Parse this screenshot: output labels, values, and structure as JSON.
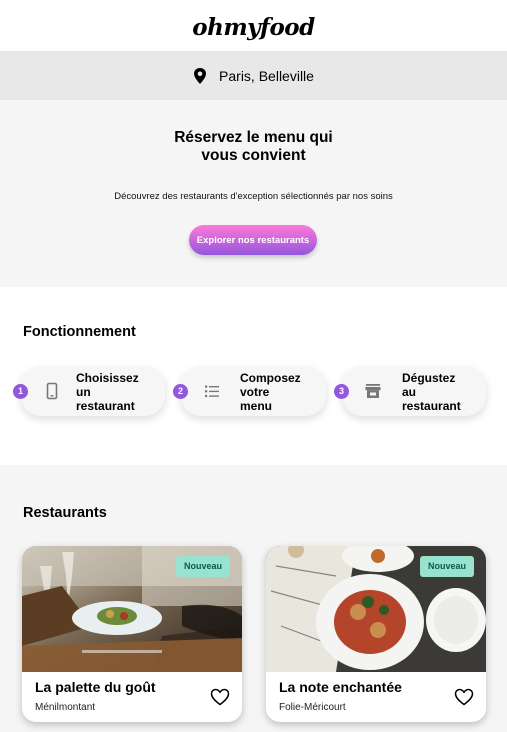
{
  "header": {
    "logo": "ohmyfood"
  },
  "location": {
    "icon": "map-pin-icon",
    "text": "Paris, Belleville"
  },
  "hero": {
    "title_line1": "Réservez le menu qui",
    "title_line2": "vous convient",
    "subtitle": "Découvrez des restaurants d'exception sélectionnés par nos soins",
    "cta_label": "Explorer nos restaurants"
  },
  "how_it_works": {
    "title": "Fonctionnement",
    "steps": [
      {
        "number": "1",
        "icon": "mobile-phone-icon",
        "lines": [
          "Choisissez",
          "un",
          "restaurant"
        ]
      },
      {
        "number": "2",
        "icon": "list-icon",
        "lines": [
          "Composez",
          "votre",
          "menu"
        ]
      },
      {
        "number": "3",
        "icon": "store-icon",
        "lines": [
          "Dégustez",
          "au",
          "restaurant"
        ]
      }
    ]
  },
  "restaurants": {
    "title": "Restaurants",
    "items": [
      {
        "name": "La palette du goût",
        "area": "Ménilmontant",
        "badge": "Nouveau",
        "liked": false
      },
      {
        "name": "La note enchantée",
        "area": "Folie-Méricourt",
        "badge": "Nouveau",
        "liked": false
      }
    ]
  },
  "colors": {
    "accent_pink": "#ff79da",
    "accent_purple": "#9356dc",
    "badge_bg": "#99e2d0",
    "badge_text": "#0a5c46"
  }
}
